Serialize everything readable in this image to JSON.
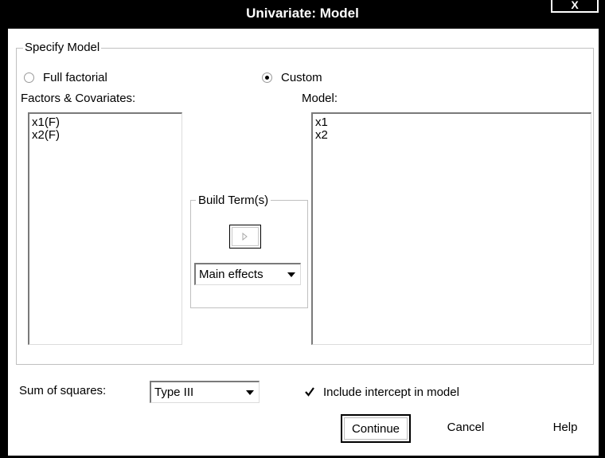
{
  "window": {
    "title": "Univariate: Model",
    "close_label": "X"
  },
  "specify_model": {
    "label": "Specify Model",
    "options": [
      {
        "label": "Full factorial",
        "selected": false
      },
      {
        "label": "Custom",
        "selected": true
      }
    ]
  },
  "factors": {
    "label": "Factors & Covariates:",
    "items": [
      "x1(F)",
      "x2(F)"
    ]
  },
  "model": {
    "label": "Model:",
    "items": [
      "x1",
      "x2"
    ]
  },
  "build_terms": {
    "label": "Build Term(s)",
    "arrow_icon": "right-arrow-icon",
    "type_selected": "Main effects"
  },
  "sum_of_squares": {
    "label": "Sum of squares:",
    "selected": "Type III"
  },
  "intercept": {
    "label": "Include intercept in model",
    "checked": true
  },
  "buttons": {
    "continue": "Continue",
    "cancel": "Cancel",
    "help": "Help"
  }
}
